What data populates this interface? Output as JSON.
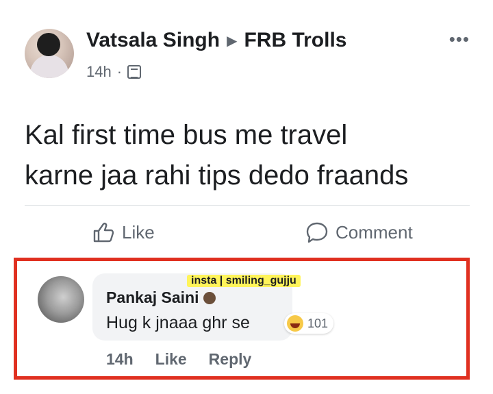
{
  "post": {
    "author": "Vatsala Singh",
    "group": "FRB Trolls",
    "time": "14h",
    "dot": "·",
    "more_icon": "more-horizontal-icon",
    "text_line1": "Kal first time bus me travel",
    "text_line2": "karne jaa rahi tips dedo fraands"
  },
  "actions": {
    "like_label": "Like",
    "comment_label": "Comment"
  },
  "comment": {
    "watermark": "insta | smiling_gujju",
    "author": "Pankaj Saini",
    "text": "Hug k jnaaa ghr se",
    "reaction_count": "101",
    "time": "14h",
    "like_label": "Like",
    "reply_label": "Reply"
  },
  "colors": {
    "highlight_border": "#e03020",
    "watermark_bg": "#fff45a",
    "secondary_text": "#606770"
  }
}
